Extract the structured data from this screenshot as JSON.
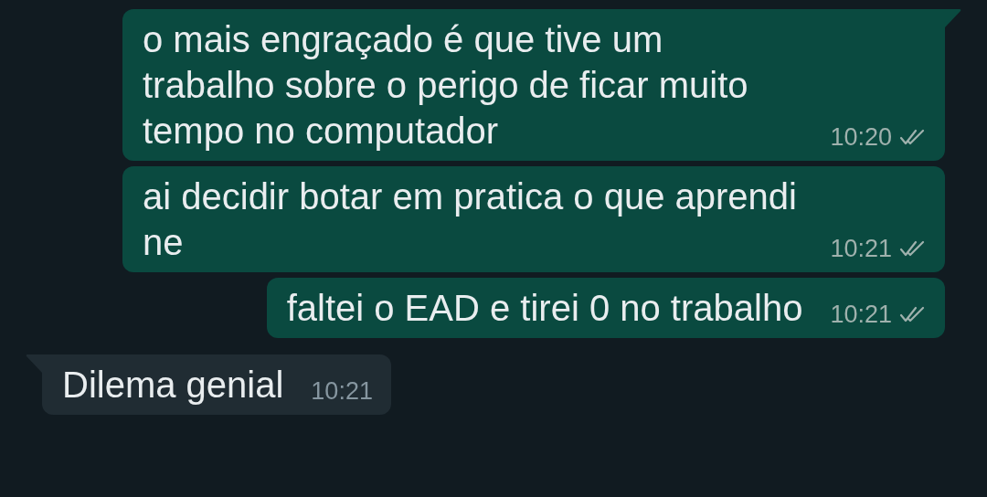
{
  "messages": [
    {
      "kind": "outgoing",
      "text": "o mais engraçado é que tive um trabalho sobre o perigo de ficar muito tempo no computador",
      "time": "10:20",
      "tail": true,
      "read": false
    },
    {
      "kind": "outgoing",
      "text": "ai decidir botar em pratica o que aprendi ne",
      "time": "10:21",
      "tail": false,
      "read": false
    },
    {
      "kind": "outgoing",
      "text": "faltei o EAD e tirei 0 no trabalho",
      "time": "10:21",
      "tail": false,
      "read": false
    },
    {
      "kind": "incoming",
      "text": "Dilema genial",
      "time": "10:21",
      "tail": true
    }
  ]
}
